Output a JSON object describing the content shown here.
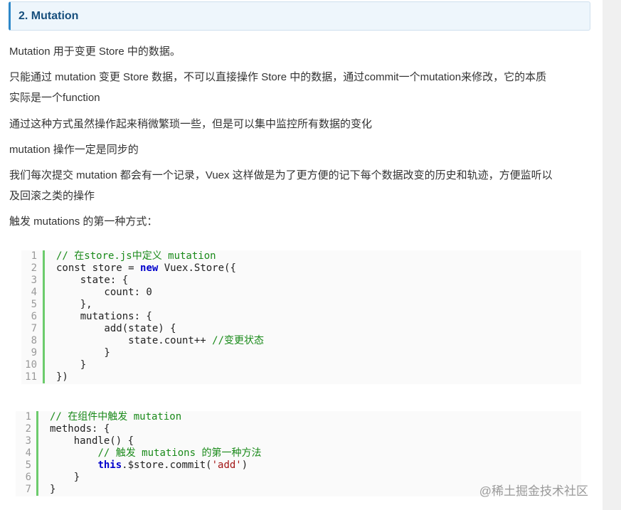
{
  "heading": "2. Mutation",
  "paragraphs": [
    "Mutation 用于变更 Store 中的数据。",
    "只能通过 mutation 变更 Store 数据，不可以直接操作 Store 中的数据，通过commit一个mutation来修改，它的本质",
    "实际是一个function",
    "通过这种方式虽然操作起来稍微繁琐一些，但是可以集中监控所有数据的变化",
    "mutation 操作一定是同步的",
    "我们每次提交 mutation 都会有一个记录，Vuex 这样做是为了更方便的记下每个数据改变的历史和轨迹，方便监听以",
    "及回滚之类的操作",
    "触发 mutations 的第一种方式："
  ],
  "code1": {
    "line_numbers": [
      "1",
      "2",
      "3",
      "4",
      "5",
      "6",
      "7",
      "8",
      "9",
      "10",
      "11"
    ],
    "lines": [
      {
        "a": "",
        "cm": "// 在store.js中定义 mutation"
      },
      {
        "a": "const store = ",
        "kw": "new",
        "b": " Vuex.Store({"
      },
      {
        "a": "    state: {"
      },
      {
        "a": "        count: 0"
      },
      {
        "a": "    },"
      },
      {
        "a": "    mutations: {"
      },
      {
        "a": "        add(state) {"
      },
      {
        "a": "            state.count++ ",
        "cm": "//变更状态"
      },
      {
        "a": "        }"
      },
      {
        "a": "    }"
      },
      {
        "a": "})"
      }
    ]
  },
  "code2": {
    "line_numbers": [
      "1",
      "2",
      "3",
      "4",
      "5",
      "6",
      "7"
    ],
    "lines": [
      {
        "a": "",
        "cm": "// 在组件中触发 mutation"
      },
      {
        "a": "methods: {"
      },
      {
        "a": "    handle() {"
      },
      {
        "a": "        ",
        "cm": "// 触发 mutations 的第一种方法"
      },
      {
        "a": "        ",
        "kw": "this",
        "b": ".$store.commit(",
        "str": "'add'",
        "c": ")"
      },
      {
        "a": "    }"
      },
      {
        "a": "}"
      }
    ]
  },
  "watermark": "@稀土掘金技术社区"
}
